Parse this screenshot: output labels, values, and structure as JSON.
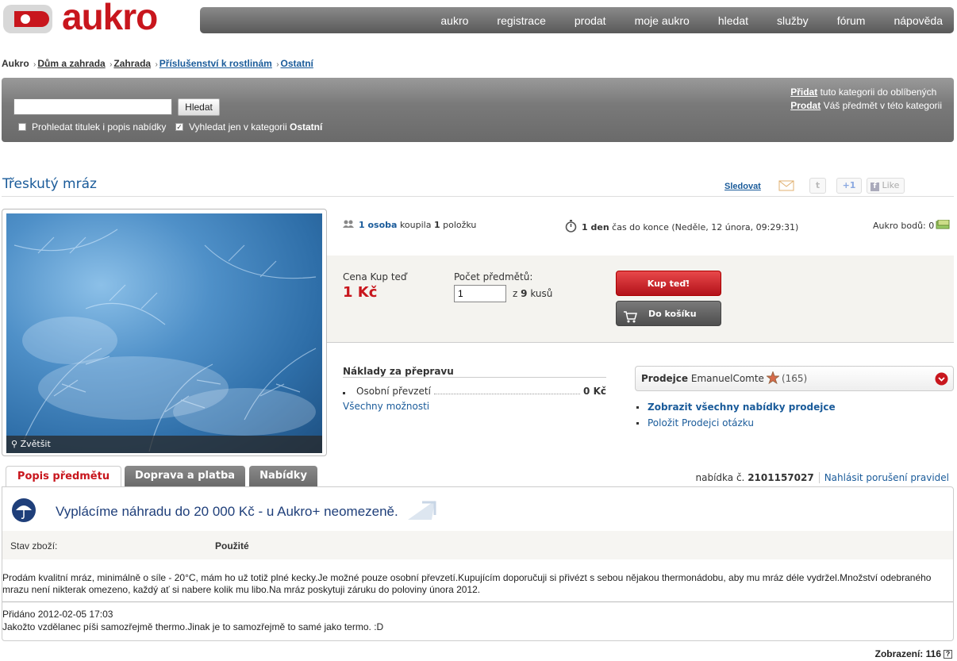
{
  "header": {
    "logo_text": "aukro",
    "nav": [
      "aukro",
      "registrace",
      "prodat",
      "moje aukro",
      "hledat",
      "služby",
      "fórum",
      "nápověda"
    ]
  },
  "breadcrumb": {
    "root": "Aukro",
    "items": [
      "Dům a zahrada",
      "Zahrada",
      "Příslušenství k rostlinám",
      "Ostatní"
    ]
  },
  "search": {
    "value": "",
    "button": "Hledat",
    "opt_title_desc": "Prohledat titulek i popis nabídky",
    "opt_category_prefix": "Vyhledat jen v kategorii",
    "opt_category_name": "Ostatní",
    "right_add_link": "Přidat",
    "right_add_text": "tuto kategorii do oblíbených",
    "right_sell_link": "Prodat",
    "right_sell_text": "Váš předmět v této kategorii"
  },
  "item": {
    "title": "Třeskutý mráz",
    "follow": "Sledovat",
    "like": "Like",
    "plus_one": "+1",
    "zoom": "Zvětšit"
  },
  "stats": {
    "buyers_link": "1 osoba",
    "bought_text": "koupila",
    "bought_count": "1",
    "bought_unit": "položku",
    "time_left": "1 den",
    "time_text": "čas do konce (Neděle, 12 února, 09:29:31)",
    "points_label": "Aukro bodů:",
    "points": "0"
  },
  "buy": {
    "price_label": "Cena Kup teď",
    "price": "1 Kč",
    "qty_label": "Počet předmětů:",
    "qty_value": "1",
    "qty_of": "z",
    "qty_total": "9",
    "qty_unit": "kusů",
    "buy_button": "Kup teď!",
    "cart_button": "Do košíku"
  },
  "shipping": {
    "title": "Náklady za přepravu",
    "method": "Osobní převzetí",
    "price": "0 Kč",
    "all_link": "Všechny možnosti"
  },
  "seller": {
    "label": "Prodejce",
    "name": "EmanuelComte",
    "rating": "(165)",
    "link_all": "Zobrazit všechny nabídky prodejce",
    "link_ask": "Položit Prodejci otázku"
  },
  "tabs": [
    "Popis předmětu",
    "Doprava a platba",
    "Nabídky"
  ],
  "offer": {
    "label": "nabídka č.",
    "number": "2101157027",
    "report": "Nahlásit porušení pravidel"
  },
  "description": {
    "banner": "Vyplácíme náhradu do 20 000 Kč - u Aukro+ neomezeně.",
    "condition_label": "Stav zboží:",
    "condition_value": "Použité",
    "text": "Prodám kvalitní mráz, minimálně o síle - 20°C, mám ho už totiž plné kecky.Je možné pouze osobní převzetí.Kupujícím doporučuji si přivézt s sebou nějakou thermonádobu, aby mu mráz déle vydržel.Množství odebraného mrazu není nikterak omezeno, každý ať si nabere kolik mu libo.Na mráz poskytuji záruku do poloviny února 2012.",
    "added_label": "Přidáno 2012-02-05 17:03",
    "added_text": "Jakožto vzdělanec píši samozřejmě thermo.Jinak je to samozřejmě to samé jako termo. :D"
  },
  "footer": {
    "views_label": "Zobrazení:",
    "views": "116",
    "help": "?"
  }
}
